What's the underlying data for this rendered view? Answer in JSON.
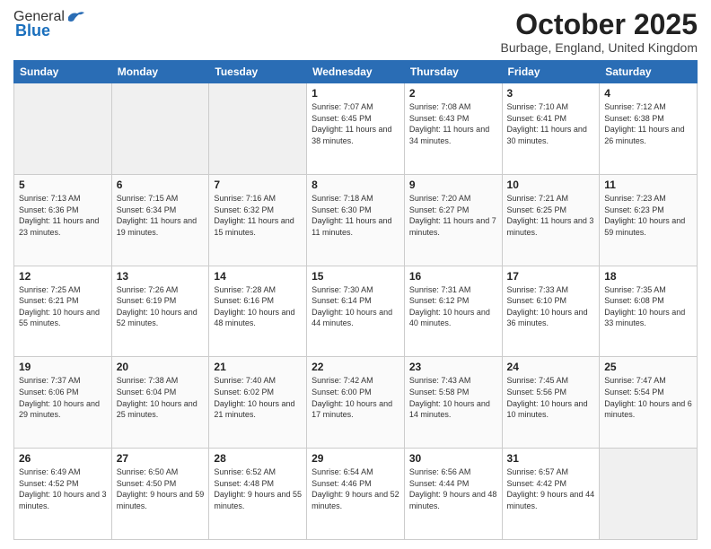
{
  "header": {
    "logo_general": "General",
    "logo_blue": "Blue",
    "month_title": "October 2025",
    "location": "Burbage, England, United Kingdom"
  },
  "days_of_week": [
    "Sunday",
    "Monday",
    "Tuesday",
    "Wednesday",
    "Thursday",
    "Friday",
    "Saturday"
  ],
  "weeks": [
    [
      {
        "day": "",
        "empty": true
      },
      {
        "day": "",
        "empty": true
      },
      {
        "day": "",
        "empty": true
      },
      {
        "day": "1",
        "sunrise": "7:07 AM",
        "sunset": "6:45 PM",
        "daylight": "11 hours and 38 minutes."
      },
      {
        "day": "2",
        "sunrise": "7:08 AM",
        "sunset": "6:43 PM",
        "daylight": "11 hours and 34 minutes."
      },
      {
        "day": "3",
        "sunrise": "7:10 AM",
        "sunset": "6:41 PM",
        "daylight": "11 hours and 30 minutes."
      },
      {
        "day": "4",
        "sunrise": "7:12 AM",
        "sunset": "6:38 PM",
        "daylight": "11 hours and 26 minutes."
      }
    ],
    [
      {
        "day": "5",
        "sunrise": "7:13 AM",
        "sunset": "6:36 PM",
        "daylight": "11 hours and 23 minutes."
      },
      {
        "day": "6",
        "sunrise": "7:15 AM",
        "sunset": "6:34 PM",
        "daylight": "11 hours and 19 minutes."
      },
      {
        "day": "7",
        "sunrise": "7:16 AM",
        "sunset": "6:32 PM",
        "daylight": "11 hours and 15 minutes."
      },
      {
        "day": "8",
        "sunrise": "7:18 AM",
        "sunset": "6:30 PM",
        "daylight": "11 hours and 11 minutes."
      },
      {
        "day": "9",
        "sunrise": "7:20 AM",
        "sunset": "6:27 PM",
        "daylight": "11 hours and 7 minutes."
      },
      {
        "day": "10",
        "sunrise": "7:21 AM",
        "sunset": "6:25 PM",
        "daylight": "11 hours and 3 minutes."
      },
      {
        "day": "11",
        "sunrise": "7:23 AM",
        "sunset": "6:23 PM",
        "daylight": "10 hours and 59 minutes."
      }
    ],
    [
      {
        "day": "12",
        "sunrise": "7:25 AM",
        "sunset": "6:21 PM",
        "daylight": "10 hours and 55 minutes."
      },
      {
        "day": "13",
        "sunrise": "7:26 AM",
        "sunset": "6:19 PM",
        "daylight": "10 hours and 52 minutes."
      },
      {
        "day": "14",
        "sunrise": "7:28 AM",
        "sunset": "6:16 PM",
        "daylight": "10 hours and 48 minutes."
      },
      {
        "day": "15",
        "sunrise": "7:30 AM",
        "sunset": "6:14 PM",
        "daylight": "10 hours and 44 minutes."
      },
      {
        "day": "16",
        "sunrise": "7:31 AM",
        "sunset": "6:12 PM",
        "daylight": "10 hours and 40 minutes."
      },
      {
        "day": "17",
        "sunrise": "7:33 AM",
        "sunset": "6:10 PM",
        "daylight": "10 hours and 36 minutes."
      },
      {
        "day": "18",
        "sunrise": "7:35 AM",
        "sunset": "6:08 PM",
        "daylight": "10 hours and 33 minutes."
      }
    ],
    [
      {
        "day": "19",
        "sunrise": "7:37 AM",
        "sunset": "6:06 PM",
        "daylight": "10 hours and 29 minutes."
      },
      {
        "day": "20",
        "sunrise": "7:38 AM",
        "sunset": "6:04 PM",
        "daylight": "10 hours and 25 minutes."
      },
      {
        "day": "21",
        "sunrise": "7:40 AM",
        "sunset": "6:02 PM",
        "daylight": "10 hours and 21 minutes."
      },
      {
        "day": "22",
        "sunrise": "7:42 AM",
        "sunset": "6:00 PM",
        "daylight": "10 hours and 17 minutes."
      },
      {
        "day": "23",
        "sunrise": "7:43 AM",
        "sunset": "5:58 PM",
        "daylight": "10 hours and 14 minutes."
      },
      {
        "day": "24",
        "sunrise": "7:45 AM",
        "sunset": "5:56 PM",
        "daylight": "10 hours and 10 minutes."
      },
      {
        "day": "25",
        "sunrise": "7:47 AM",
        "sunset": "5:54 PM",
        "daylight": "10 hours and 6 minutes."
      }
    ],
    [
      {
        "day": "26",
        "sunrise": "6:49 AM",
        "sunset": "4:52 PM",
        "daylight": "10 hours and 3 minutes."
      },
      {
        "day": "27",
        "sunrise": "6:50 AM",
        "sunset": "4:50 PM",
        "daylight": "9 hours and 59 minutes."
      },
      {
        "day": "28",
        "sunrise": "6:52 AM",
        "sunset": "4:48 PM",
        "daylight": "9 hours and 55 minutes."
      },
      {
        "day": "29",
        "sunrise": "6:54 AM",
        "sunset": "4:46 PM",
        "daylight": "9 hours and 52 minutes."
      },
      {
        "day": "30",
        "sunrise": "6:56 AM",
        "sunset": "4:44 PM",
        "daylight": "9 hours and 48 minutes."
      },
      {
        "day": "31",
        "sunrise": "6:57 AM",
        "sunset": "4:42 PM",
        "daylight": "9 hours and 44 minutes."
      },
      {
        "day": "",
        "empty": true
      }
    ]
  ],
  "labels": {
    "sunrise": "Sunrise:",
    "sunset": "Sunset:",
    "daylight": "Daylight:"
  }
}
